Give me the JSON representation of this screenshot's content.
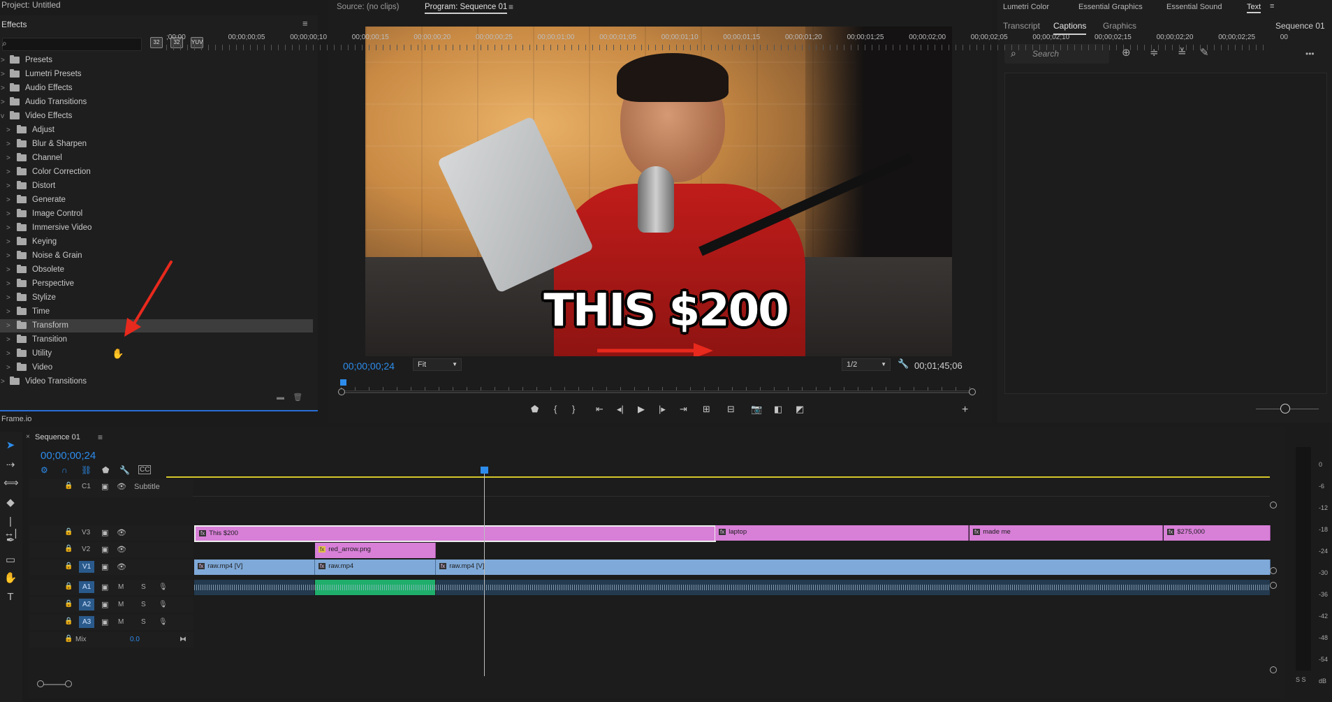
{
  "project_title": "Project: Untitled",
  "effects": {
    "title": "Effects",
    "menu_icon": "≡",
    "search_placeholder": "",
    "header_icons": [
      "32",
      "32",
      "YUV"
    ],
    "tree": [
      {
        "label": "Presets",
        "level": 0,
        "chevron": ">"
      },
      {
        "label": "Lumetri Presets",
        "level": 0,
        "chevron": ">"
      },
      {
        "label": "Audio Effects",
        "level": 0,
        "chevron": ">"
      },
      {
        "label": "Audio Transitions",
        "level": 0,
        "chevron": ">"
      },
      {
        "label": "Video Effects",
        "level": 0,
        "chevron": "v"
      },
      {
        "label": "Adjust",
        "level": 1,
        "chevron": ">"
      },
      {
        "label": "Blur & Sharpen",
        "level": 1,
        "chevron": ">"
      },
      {
        "label": "Channel",
        "level": 1,
        "chevron": ">"
      },
      {
        "label": "Color Correction",
        "level": 1,
        "chevron": ">"
      },
      {
        "label": "Distort",
        "level": 1,
        "chevron": ">"
      },
      {
        "label": "Generate",
        "level": 1,
        "chevron": ">"
      },
      {
        "label": "Image Control",
        "level": 1,
        "chevron": ">"
      },
      {
        "label": "Immersive Video",
        "level": 1,
        "chevron": ">"
      },
      {
        "label": "Keying",
        "level": 1,
        "chevron": ">"
      },
      {
        "label": "Noise & Grain",
        "level": 1,
        "chevron": ">"
      },
      {
        "label": "Obsolete",
        "level": 1,
        "chevron": ">"
      },
      {
        "label": "Perspective",
        "level": 1,
        "chevron": ">"
      },
      {
        "label": "Stylize",
        "level": 1,
        "chevron": ">"
      },
      {
        "label": "Time",
        "level": 1,
        "chevron": ">"
      },
      {
        "label": "Transform",
        "level": 1,
        "chevron": ">",
        "selected": true
      },
      {
        "label": "Transition",
        "level": 1,
        "chevron": ">"
      },
      {
        "label": "Utility",
        "level": 1,
        "chevron": ">"
      },
      {
        "label": "Video",
        "level": 1,
        "chevron": ">"
      },
      {
        "label": "Video Transitions",
        "level": 0,
        "chevron": ">"
      }
    ]
  },
  "frameio_label": "Frame.io",
  "monitor": {
    "source_tab": "Source: (no clips)",
    "program_tab": "Program: Sequence 01",
    "tab_menu_icon": "≡",
    "caption_overlay": "THIS $200",
    "current_timecode": "00;00;00;24",
    "fit_value": "Fit",
    "resolution_value": "1/2",
    "duration_timecode": "00;01;45;06",
    "add_button": "+"
  },
  "workspaces": {
    "tabs": [
      "Lumetri Color",
      "Essential Graphics",
      "Essential Sound",
      "Text"
    ],
    "menu_icon": "≡",
    "subtabs": [
      "Transcript",
      "Captions",
      "Graphics"
    ],
    "sequence_name": "Sequence 01",
    "search_placeholder": "Search",
    "more_icon": "•••"
  },
  "timeline": {
    "sequence_tab": "Sequence 01",
    "close_icon": "×",
    "menu_icon": "≡",
    "timecode": "00;00;00;24",
    "ruler_labels": [
      ";00;00",
      "00;00;00;05",
      "00;00;00;10",
      "00;00;00;15",
      "00;00;00;20",
      "00;00;00;25",
      "00;00;01;00",
      "00;00;01;05",
      "00;00;01;10",
      "00;00;01;15",
      "00;00;01;20",
      "00;00;01;25",
      "00;00;02;00",
      "00;00;02;05",
      "00;00;02;10",
      "00;00;02;15",
      "00;00;02;20",
      "00;00;02;25",
      "00"
    ],
    "tracks": {
      "c1": {
        "name": "C1",
        "label": "Subtitle"
      },
      "v3": {
        "name": "V3"
      },
      "v2": {
        "name": "V2"
      },
      "v1": {
        "name": "V1"
      },
      "a1": {
        "name": "A1",
        "m": "M",
        "s": "S"
      },
      "a2": {
        "name": "A2",
        "m": "M",
        "s": "S"
      },
      "a3": {
        "name": "A3",
        "m": "M",
        "s": "S"
      },
      "mix": {
        "name": "Mix",
        "value": "0.0"
      }
    },
    "clips": {
      "v3": [
        "This $200",
        "laptop",
        "made me",
        "$275,000"
      ],
      "v2": [
        "red_arrow.png"
      ],
      "v1": [
        "raw.mp4 [V]",
        "raw.mp4",
        "raw.mp4 [V]"
      ]
    },
    "fx_badge": "fx"
  },
  "meter": {
    "labels": [
      "0",
      "-6",
      "-12",
      "-18",
      "-24",
      "-30",
      "-36",
      "-42",
      "-48",
      "-54",
      "dB"
    ],
    "solo": "S S"
  },
  "colors": {
    "accent_blue": "#2d8ceb",
    "clip_pink": "#d87fd8",
    "clip_blue": "#7fa9d8",
    "audio_selected": "#1fae6b",
    "annotation_red": "#e8291d"
  }
}
